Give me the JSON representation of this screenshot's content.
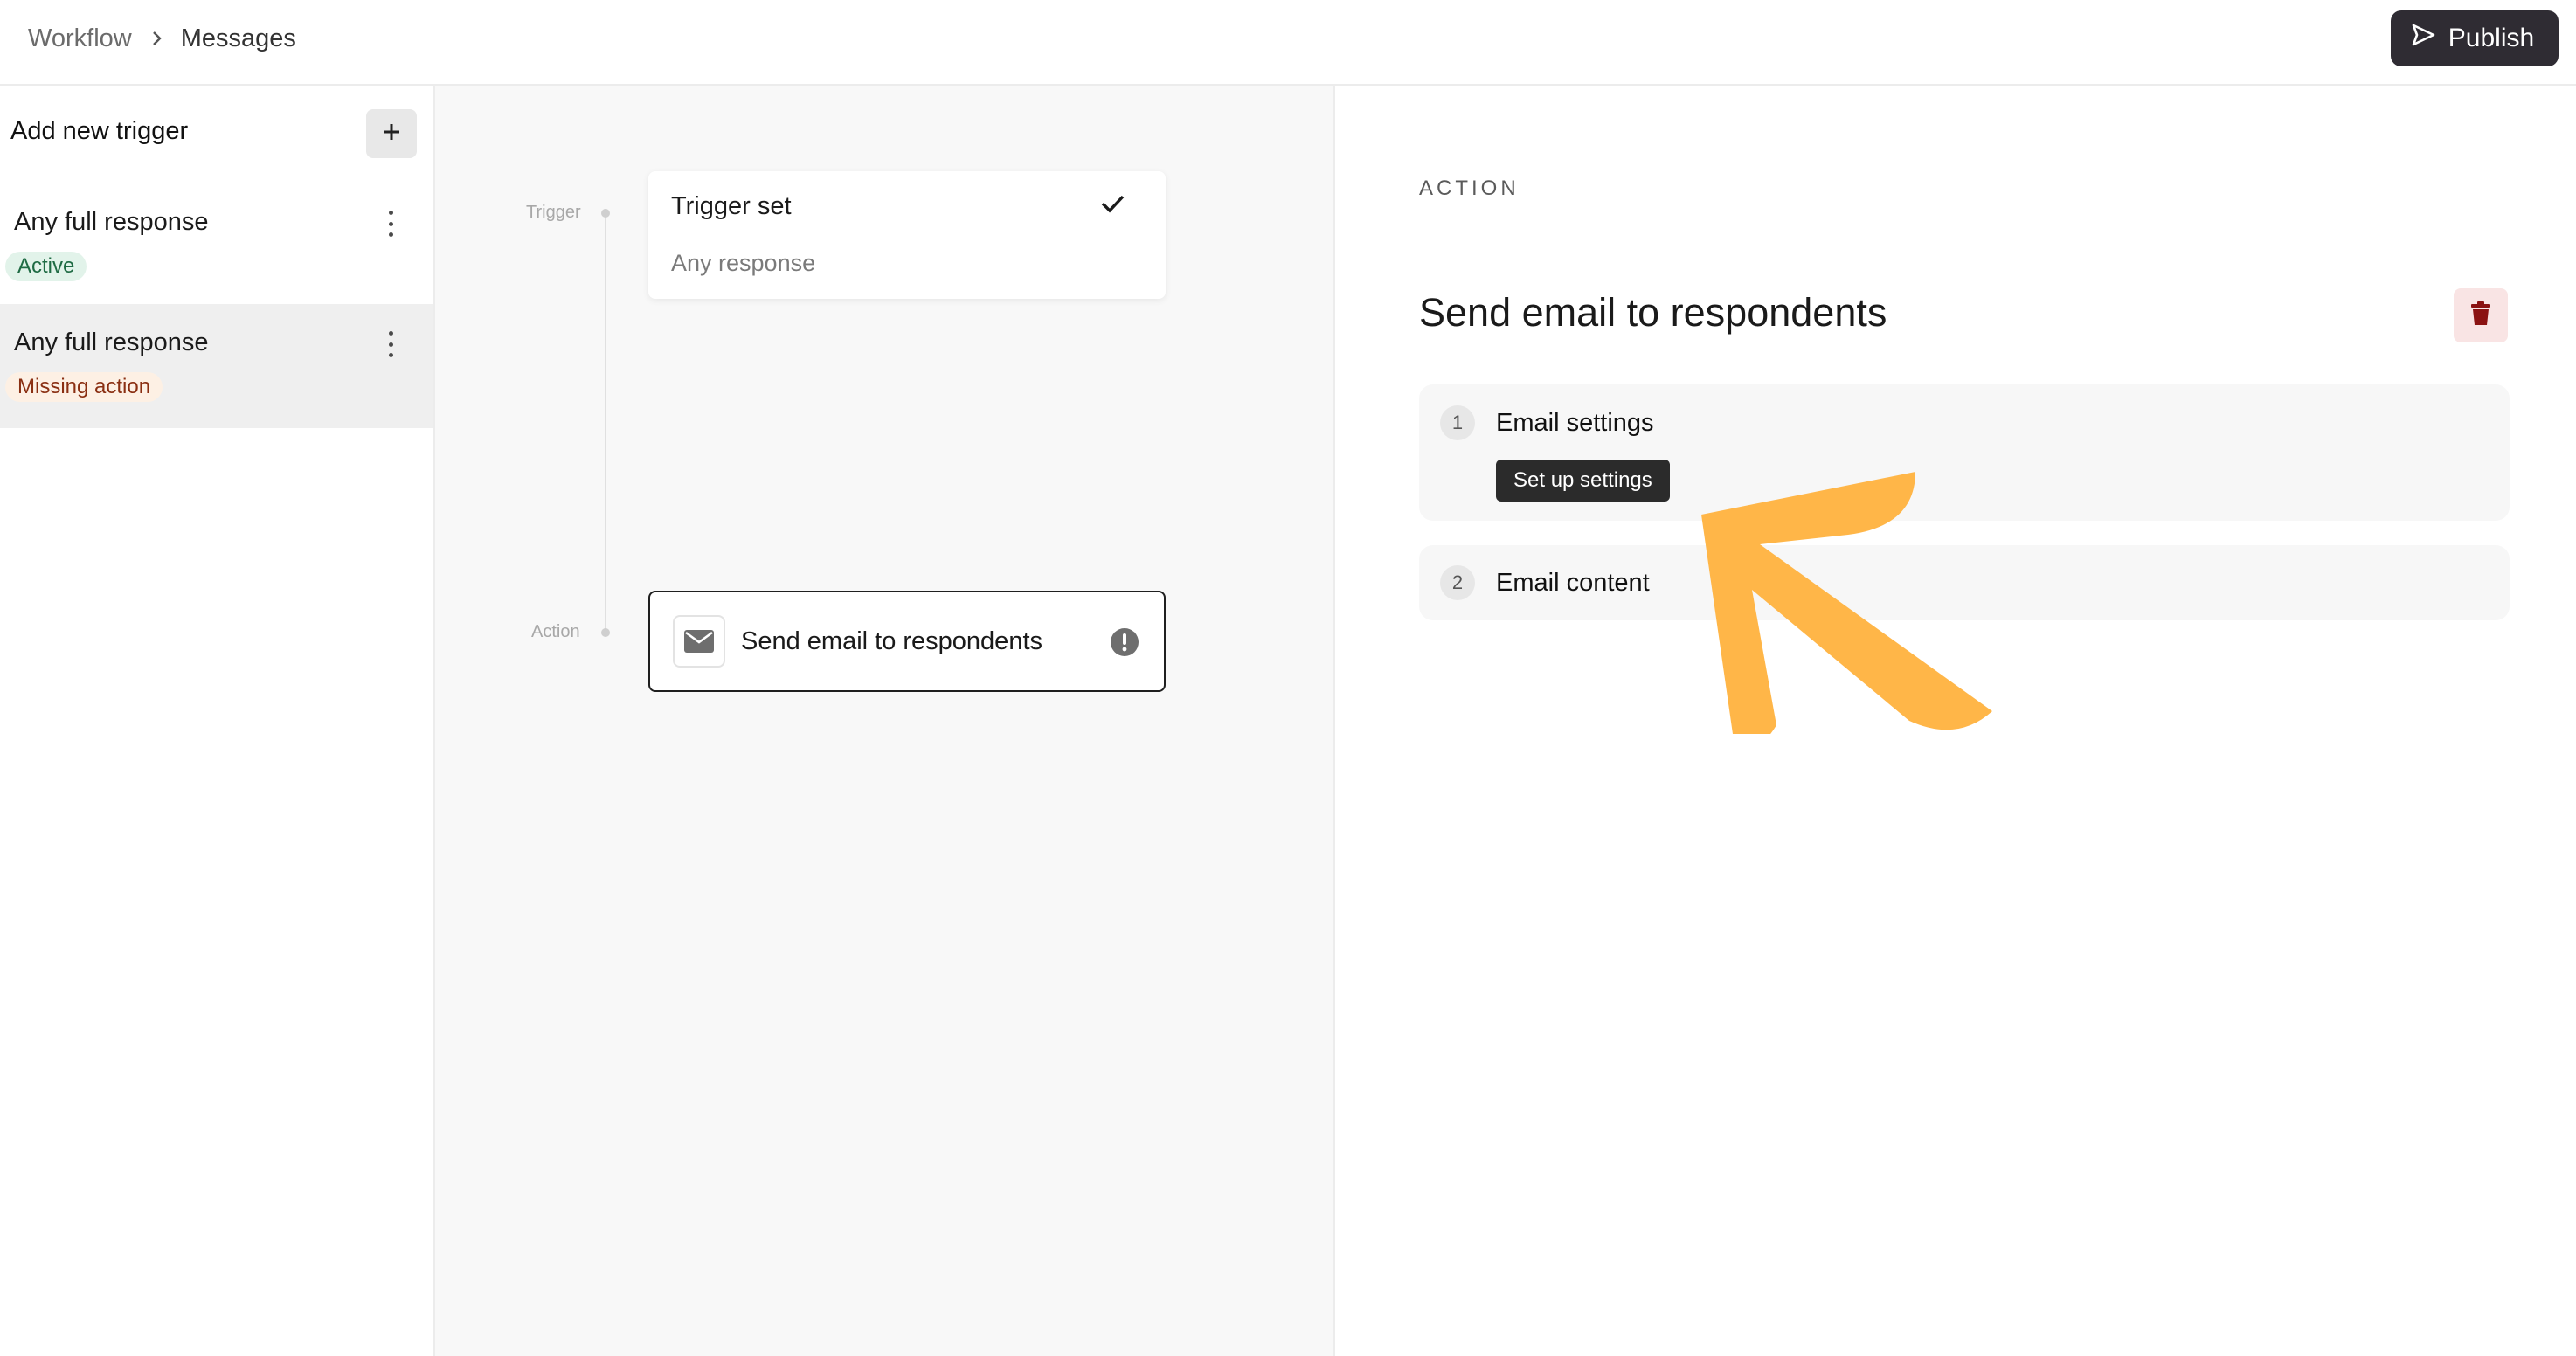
{
  "header": {
    "breadcrumb": [
      "Workflow",
      "Messages"
    ],
    "publish_label": "Publish"
  },
  "sidebar": {
    "title": "Add new trigger",
    "triggers": [
      {
        "name": "Any full response",
        "status": "Active"
      },
      {
        "name": "Any full response",
        "status": "Missing action"
      }
    ]
  },
  "canvas": {
    "rail_labels": {
      "trigger": "Trigger",
      "action": "Action"
    },
    "trigger_card": {
      "title": "Trigger set",
      "subtitle": "Any response"
    },
    "action_card": {
      "title": "Send email to respondents"
    }
  },
  "panel": {
    "eyebrow": "ACTION",
    "title": "Send email to respondents",
    "steps": [
      {
        "num": "1",
        "label": "Email settings",
        "button": "Set up settings"
      },
      {
        "num": "2",
        "label": "Email content"
      }
    ]
  },
  "colors": {
    "accent_dark": "#2f2c33",
    "badge_active_bg": "#e2f3ea",
    "badge_missing_bg": "#fdf0e4",
    "delete_icon": "#8b1212",
    "annotation_arrow": "#FFB648"
  },
  "icons": {
    "publish": "send-icon",
    "add": "plus-icon",
    "trigger_menu": "kebab-icon",
    "trigger_done": "check-icon",
    "action_type": "mail-icon",
    "action_warning": "alert-icon",
    "delete": "trash-icon",
    "annotation": "arrow-icon"
  }
}
